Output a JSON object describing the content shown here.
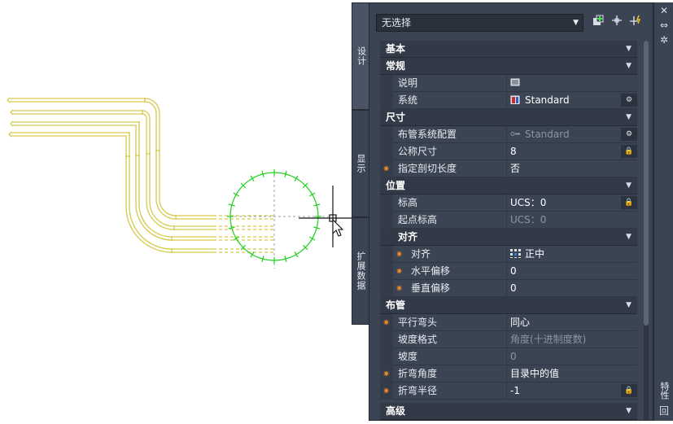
{
  "palette": {
    "selector_value": "无选择",
    "tabs": [
      "设计",
      "显示",
      "扩展数据"
    ],
    "side_title": "特性",
    "colors": {
      "accent_star": "#f08a2a",
      "pipe_yellow": "#d6c94b",
      "circle_green": "#1fd11f"
    }
  },
  "properties": {
    "basic": "基本",
    "general": "常规",
    "general_rows": [
      {
        "name": "说明",
        "value": ""
      },
      {
        "name": "系统",
        "value": "Standard"
      }
    ],
    "dimension": "尺寸",
    "dimension_rows": [
      {
        "name": "布管系统配置",
        "value": "Standard"
      },
      {
        "name": "公称尺寸",
        "value": "8"
      },
      {
        "name": "指定剖切长度",
        "value": "否"
      }
    ],
    "location": "位置",
    "location_rows": [
      {
        "name": "标高",
        "value": "UCS：0"
      },
      {
        "name": "起点标高",
        "value": "UCS：0"
      }
    ],
    "justify": "对齐",
    "justify_rows": [
      {
        "name": "对齐",
        "value": "正中"
      },
      {
        "name": "水平偏移",
        "value": "0"
      },
      {
        "name": "垂直偏移",
        "value": "0"
      }
    ],
    "routing": "布管",
    "routing_rows": [
      {
        "name": "平行弯头",
        "value": "同心"
      },
      {
        "name": "坡度格式",
        "value": "角度(十进制度数)"
      },
      {
        "name": "坡度",
        "value": "0"
      },
      {
        "name": "折弯角度",
        "value": "目录中的值"
      },
      {
        "name": "折弯半径",
        "value": "-1"
      }
    ],
    "advanced": "高级"
  }
}
